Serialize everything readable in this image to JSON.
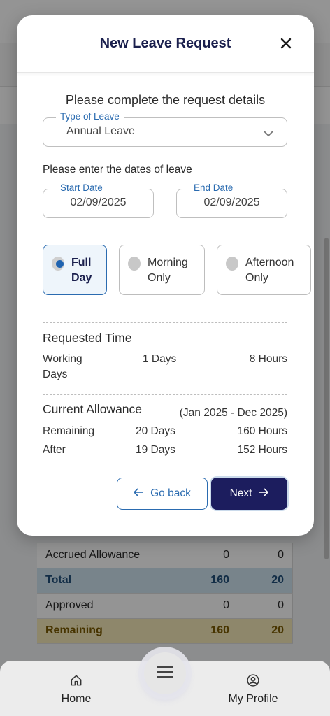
{
  "modal": {
    "title": "New Leave Request",
    "subtitle": "Please complete the request details",
    "leave_type": {
      "label": "Type of Leave",
      "value": "Annual Leave"
    },
    "dates_label": "Please enter the dates of leave",
    "start_date": {
      "label": "Start Date",
      "value": "02/09/2025"
    },
    "end_date": {
      "label": "End Date",
      "value": "02/09/2025"
    },
    "duration_options": [
      {
        "line1": "Full",
        "line2": "Day",
        "selected": true
      },
      {
        "line1": "Morning",
        "line2": "Only",
        "selected": false
      },
      {
        "line1": "Afternoon",
        "line2": "Only",
        "selected": false
      }
    ],
    "requested_time": {
      "title": "Requested Time",
      "label_line1": "Working",
      "label_line2": "Days",
      "days": "1 Days",
      "hours": "8 Hours"
    },
    "current_allowance": {
      "title": "Current Allowance",
      "period": "(Jan 2025 - Dec 2025)",
      "rows": [
        {
          "label": "Remaining",
          "days": "20 Days",
          "hours": "160 Hours"
        },
        {
          "label": "After",
          "days": "19 Days",
          "hours": "152 Hours"
        }
      ]
    },
    "buttons": {
      "back": "Go back",
      "next": "Next"
    }
  },
  "background_table": [
    {
      "label": "Accrued Allowance",
      "col1": "0",
      "col2": "0",
      "style": "normal"
    },
    {
      "label": "Total",
      "col1": "160",
      "col2": "20",
      "style": "total"
    },
    {
      "label": "Approved",
      "col1": "0",
      "col2": "0",
      "style": "normal"
    },
    {
      "label": "Remaining",
      "col1": "160",
      "col2": "20",
      "style": "remaining"
    }
  ],
  "bottom_nav": {
    "home": "Home",
    "profile": "My Profile"
  },
  "colors": {
    "primary": "#1c1d5e",
    "accent": "#2a6bb0",
    "total_bg": "#cfe3f0",
    "remaining_bg": "#f5e9b8"
  }
}
